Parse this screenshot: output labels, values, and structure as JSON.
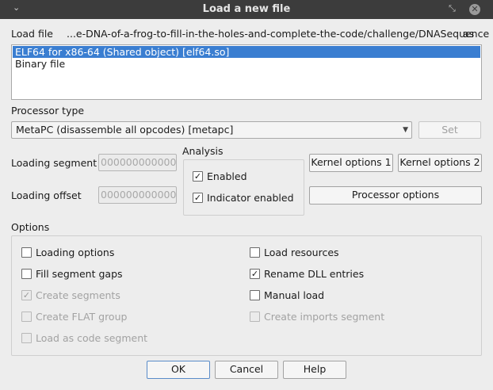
{
  "window": {
    "title": "Load a new file",
    "menu_glyph": "⌄",
    "restore_glyph": "⤡",
    "close_glyph": "✕"
  },
  "load_file": {
    "label": "Load file",
    "path": "...e-DNA-of-a-frog-to-fill-in-the-holes-and-complete-the-code/challenge/DNASequence",
    "as_label": "as",
    "formats": [
      {
        "label": "ELF64 for x86-64 (Shared object) [elf64.so]",
        "selected": true
      },
      {
        "label": "Binary file",
        "selected": false
      }
    ]
  },
  "processor": {
    "label": "Processor type",
    "value": "MetaPC (disassemble all opcodes) [metapc]",
    "set_label": "Set"
  },
  "loading": {
    "segment_label": "Loading segment",
    "segment_value": "0000000000000",
    "offset_label": "Loading offset",
    "offset_value": "0000000000000"
  },
  "analysis": {
    "label": "Analysis",
    "enabled_label": "Enabled",
    "indicator_label": "Indicator enabled"
  },
  "buttons": {
    "kernel1": "Kernel options 1",
    "kernel2": "Kernel options 2",
    "processor_options": "Processor options",
    "ok": "OK",
    "cancel": "Cancel",
    "help": "Help"
  },
  "options": {
    "label": "Options",
    "left": [
      {
        "label": "Loading options",
        "checked": false,
        "disabled": false
      },
      {
        "label": "Fill segment gaps",
        "checked": false,
        "disabled": false
      },
      {
        "label": "Create segments",
        "checked": true,
        "disabled": true
      },
      {
        "label": "Create FLAT group",
        "checked": false,
        "disabled": true
      },
      {
        "label": "Load as code segment",
        "checked": false,
        "disabled": true
      }
    ],
    "right": [
      {
        "label": "Load resources",
        "checked": false,
        "disabled": false
      },
      {
        "label": "Rename DLL entries",
        "checked": true,
        "disabled": false
      },
      {
        "label": "Manual load",
        "checked": false,
        "disabled": false
      },
      {
        "label": "Create imports segment",
        "checked": false,
        "disabled": true
      }
    ]
  }
}
